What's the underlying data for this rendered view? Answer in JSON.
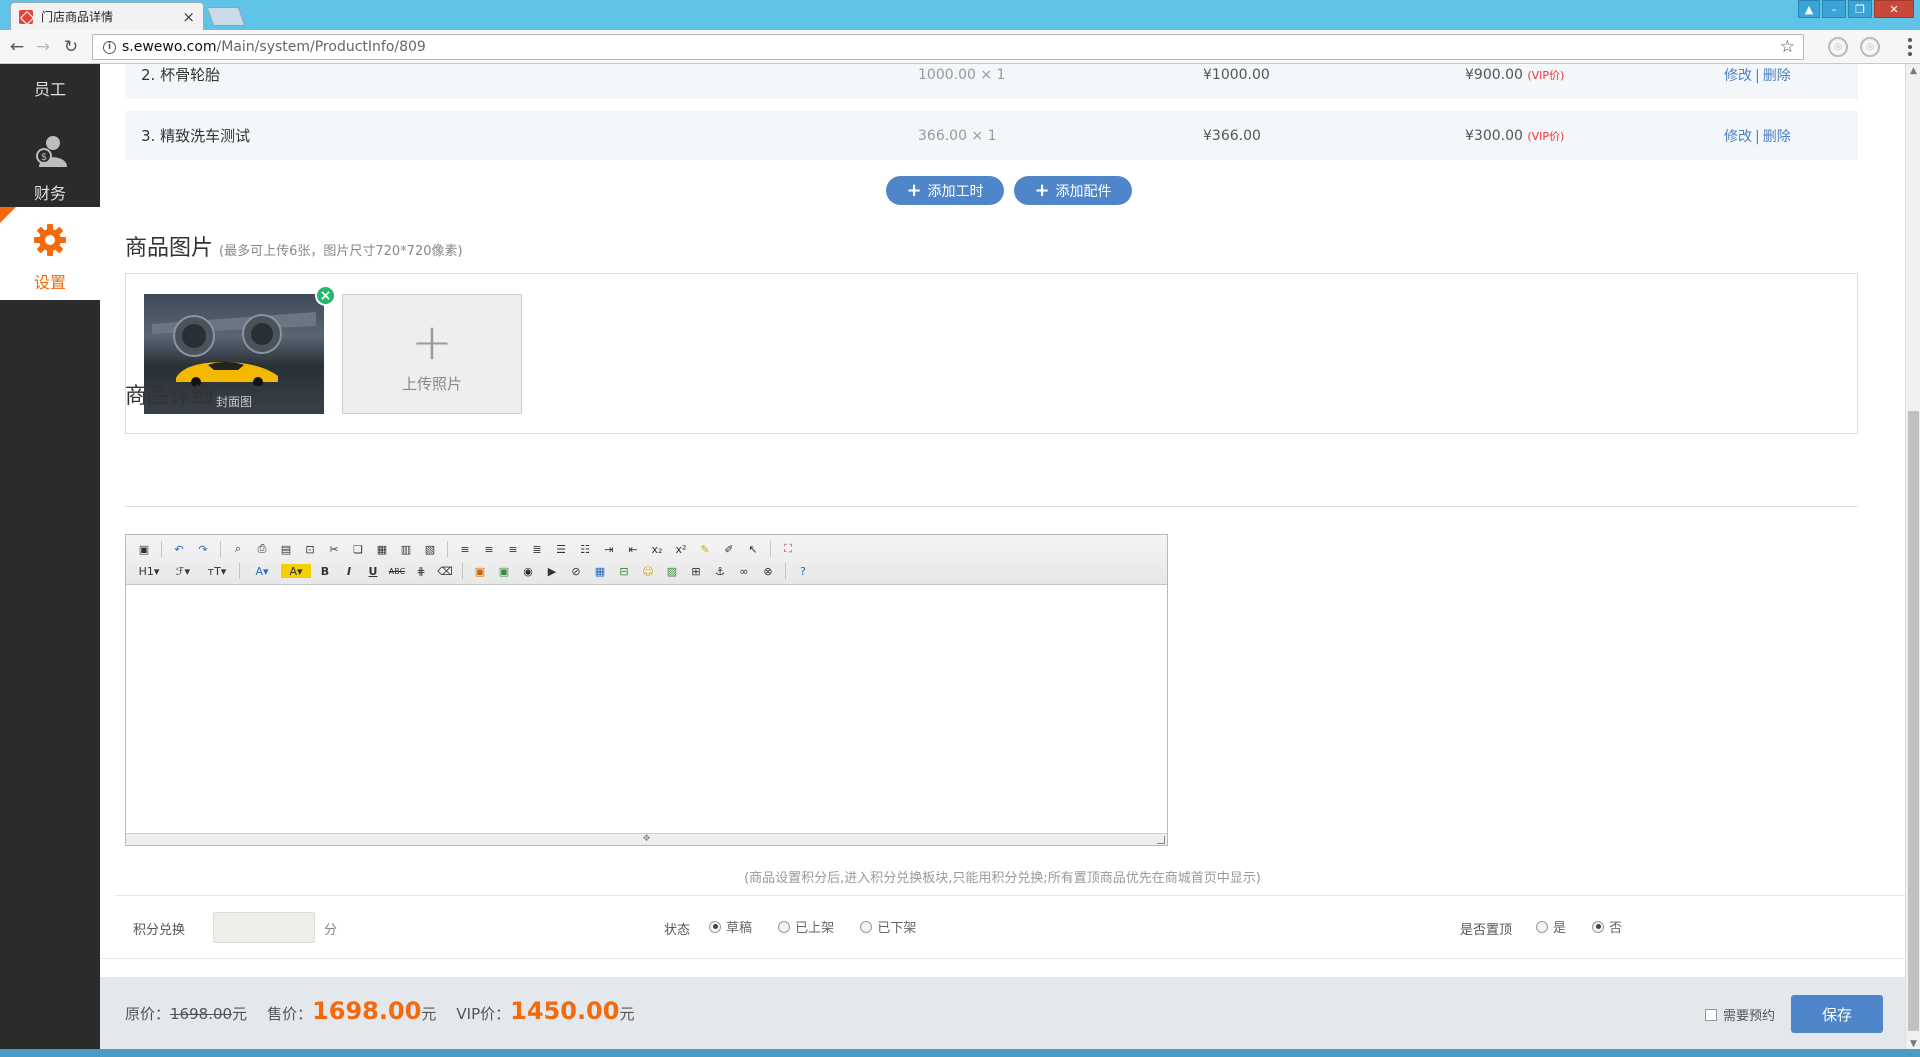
{
  "browser": {
    "tab_title": "门店商品详情",
    "url_host": "s.ewewo.com",
    "url_path": "/Main/system/ProductInfo/809"
  },
  "sidebar": {
    "items": [
      {
        "label": "员工",
        "icon": "staff-icon"
      },
      {
        "label": "财务",
        "icon": "finance-icon"
      },
      {
        "label": "设置",
        "icon": "gear-icon",
        "active": true
      }
    ]
  },
  "service_rows": [
    {
      "name": "2. 杯骨轮胎",
      "qty": "1000.00 × 1",
      "price": "¥1000.00",
      "vip_price": "¥900.00",
      "vip_tag": "(VIP价)",
      "edit": "修改",
      "sep": "|",
      "delete": "删除"
    },
    {
      "name": "3. 精致洗车测试",
      "qty": "366.00 × 1",
      "price": "¥366.00",
      "vip_price": "¥300.00",
      "vip_tag": "(VIP价)",
      "edit": "修改",
      "sep": "|",
      "delete": "删除"
    }
  ],
  "actions": {
    "add_labor": "添加工时",
    "add_parts": "添加配件"
  },
  "images_section": {
    "title": "商品图片",
    "note": "(最多可上传6张，图片尺寸720*720像素)",
    "cover_label": "封面图",
    "upload_label": "上传照片"
  },
  "detail_section": {
    "title": "商品详细"
  },
  "hint": "(商品设置积分后,进入积分兑换板块,只能用积分兑换;所有置顶商品优先在商城首页中显示)",
  "form": {
    "points_label": "积分兑换",
    "points_value": "",
    "points_unit": "分",
    "status_label": "状态",
    "status_options": [
      "草稿",
      "已上架",
      "已下架"
    ],
    "status_selected": "草稿",
    "top_label": "是否置顶",
    "top_options": [
      "是",
      "否"
    ],
    "top_selected": "否"
  },
  "footer": {
    "orig_label": "原价：",
    "orig_value": "1698.00",
    "unit": "元",
    "sale_label": "售价：",
    "sale_value": "1698.00",
    "vip_label": "VIP价：",
    "vip_value": "1450.00",
    "booking_label": "需要预约",
    "save_label": "保存"
  },
  "colors": {
    "accent": "#f26a0c",
    "primary_button": "#4f86c9",
    "sidebar_bg": "#2b2b2b",
    "titlebar": "#5fc3e8"
  }
}
